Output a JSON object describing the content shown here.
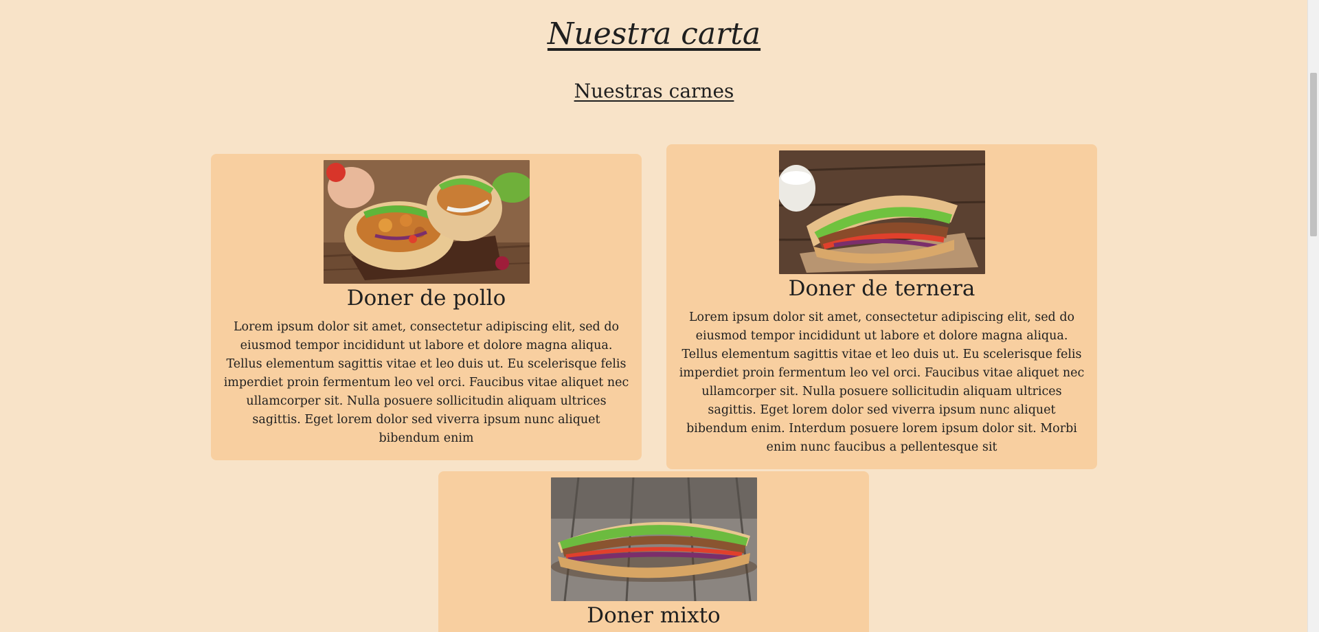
{
  "page_title": "Nuestra carta",
  "section_title": "Nuestras carnes",
  "cards": [
    {
      "title": "Doner de pollo",
      "image": "chicken-doner-pita-photo",
      "text": "Lorem ipsum dolor sit amet, consectetur adipiscing elit, sed do eiusmod tempor incididunt ut labore et dolore magna aliqua. Tellus elementum sagittis vitae et leo duis ut. Eu scelerisque felis imperdiet proin fermentum leo vel orci. Faucibus vitae aliquet nec ullamcorper sit. Nulla posuere sollicitudin aliquam ultrices sagittis. Eget lorem dolor sed viverra ipsum nunc aliquet bibendum enim"
    },
    {
      "title": "Doner de ternera",
      "image": "beef-doner-sandwich-photo",
      "text": "Lorem ipsum dolor sit amet, consectetur adipiscing elit, sed do eiusmod tempor incididunt ut labore et dolore magna aliqua. Tellus elementum sagittis vitae et leo duis ut. Eu scelerisque felis imperdiet proin fermentum leo vel orci. Faucibus vitae aliquet nec ullamcorper sit. Nulla posuere sollicitudin aliquam ultrices sagittis. Eget lorem dolor sed viverra ipsum nunc aliquet bibendum enim. Interdum posuere lorem ipsum dolor sit. Morbi enim nunc faucibus a pellentesque sit"
    },
    {
      "title": "Doner mixto",
      "image": "mixed-doner-flatbread-photo",
      "text": ""
    }
  ],
  "colors": {
    "page_background": "#f8e3c8",
    "card_background": "#f8cfa0",
    "text": "#1f1f1f"
  }
}
